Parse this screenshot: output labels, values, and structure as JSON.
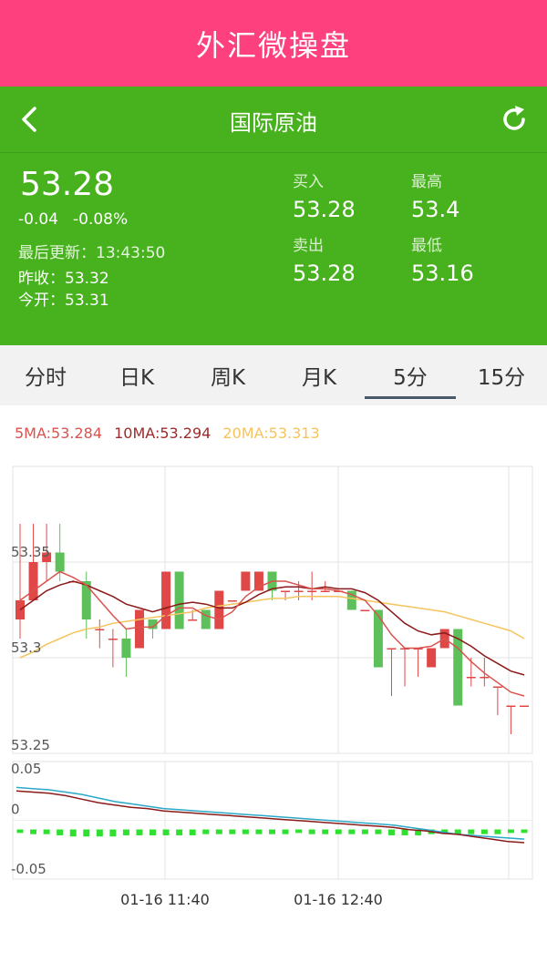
{
  "app": {
    "title": "外汇微操盘"
  },
  "nav": {
    "title": "国际原油"
  },
  "quote": {
    "price": "53.28",
    "change": "-0.04",
    "change_pct": "-0.08%",
    "updated_label": "最后更新：",
    "updated_time": "13:43:50",
    "prev_close_label": "昨收：",
    "prev_close": "53.32",
    "open_label": "今开：",
    "open": "53.31",
    "buy_label": "买入",
    "buy": "53.28",
    "high_label": "最高",
    "high": "53.4",
    "sell_label": "卖出",
    "sell": "53.28",
    "low_label": "最低",
    "low": "53.16"
  },
  "tabs": [
    {
      "label": "分时",
      "active": false
    },
    {
      "label": "日K",
      "active": false
    },
    {
      "label": "周K",
      "active": false
    },
    {
      "label": "月K",
      "active": false
    },
    {
      "label": "5分",
      "active": true
    },
    {
      "label": "15分",
      "active": false
    }
  ],
  "ma": {
    "ma5": "5MA:53.284",
    "ma10": "10MA:53.294",
    "ma20": "20MA:53.313"
  },
  "colors": {
    "up": "#e04848",
    "down": "#5ec05a",
    "ma5": "#d9534f",
    "ma10": "#8b1a1a",
    "ma20": "#f5c45e",
    "macd_line": "#2aa9c8",
    "signal_line": "#8b1a1a",
    "macd_bar": "#30e030"
  },
  "chart_data": [
    {
      "type": "candlestick",
      "y_ticks": [
        "53.35",
        "53.3",
        "53.25"
      ],
      "ylim": [
        53.25,
        53.4
      ],
      "x_ticks": [
        "01-16 11:40",
        "01-16 12:40"
      ],
      "candles": [
        {
          "o": 53.32,
          "h": 53.37,
          "l": 53.31,
          "c": 53.33
        },
        {
          "o": 53.33,
          "h": 53.37,
          "l": 53.33,
          "c": 53.35
        },
        {
          "o": 53.35,
          "h": 53.37,
          "l": 53.34,
          "c": 53.355
        },
        {
          "o": 53.355,
          "h": 53.37,
          "l": 53.34,
          "c": 53.345
        },
        {
          "o": 53.34,
          "h": 53.34,
          "l": 53.34,
          "c": 53.34
        },
        {
          "o": 53.34,
          "h": 53.345,
          "l": 53.31,
          "c": 53.32
        },
        {
          "o": 53.315,
          "h": 53.32,
          "l": 53.305,
          "c": 53.315
        },
        {
          "o": 53.31,
          "h": 53.315,
          "l": 53.295,
          "c": 53.31
        },
        {
          "o": 53.31,
          "h": 53.315,
          "l": 53.29,
          "c": 53.3
        },
        {
          "o": 53.305,
          "h": 53.325,
          "l": 53.305,
          "c": 53.325
        },
        {
          "o": 53.32,
          "h": 53.32,
          "l": 53.31,
          "c": 53.315
        },
        {
          "o": 53.315,
          "h": 53.345,
          "l": 53.315,
          "c": 53.345
        },
        {
          "o": 53.345,
          "h": 53.345,
          "l": 53.315,
          "c": 53.315
        },
        {
          "o": 53.32,
          "h": 53.325,
          "l": 53.32,
          "c": 53.32
        },
        {
          "o": 53.325,
          "h": 53.325,
          "l": 53.315,
          "c": 53.315
        },
        {
          "o": 53.315,
          "h": 53.335,
          "l": 53.315,
          "c": 53.335
        },
        {
          "o": 53.33,
          "h": 53.33,
          "l": 53.33,
          "c": 53.33
        },
        {
          "o": 53.335,
          "h": 53.345,
          "l": 53.335,
          "c": 53.345
        },
        {
          "o": 53.335,
          "h": 53.345,
          "l": 53.335,
          "c": 53.345
        },
        {
          "o": 53.345,
          "h": 53.345,
          "l": 53.33,
          "c": 53.335
        },
        {
          "o": 53.335,
          "h": 53.335,
          "l": 53.33,
          "c": 53.335
        },
        {
          "o": 53.335,
          "h": 53.34,
          "l": 53.33,
          "c": 53.335
        },
        {
          "o": 53.335,
          "h": 53.345,
          "l": 53.33,
          "c": 53.335
        },
        {
          "o": 53.335,
          "h": 53.34,
          "l": 53.335,
          "c": 53.335
        },
        {
          "o": 53.335,
          "h": 53.335,
          "l": 53.335,
          "c": 53.335
        },
        {
          "o": 53.335,
          "h": 53.335,
          "l": 53.325,
          "c": 53.325
        },
        {
          "o": 53.325,
          "h": 53.325,
          "l": 53.325,
          "c": 53.325
        },
        {
          "o": 53.325,
          "h": 53.325,
          "l": 53.295,
          "c": 53.295
        },
        {
          "o": 53.305,
          "h": 53.305,
          "l": 53.28,
          "c": 53.305
        },
        {
          "o": 53.305,
          "h": 53.305,
          "l": 53.285,
          "c": 53.305
        },
        {
          "o": 53.305,
          "h": 53.305,
          "l": 53.29,
          "c": 53.305
        },
        {
          "o": 53.295,
          "h": 53.305,
          "l": 53.295,
          "c": 53.305
        },
        {
          "o": 53.305,
          "h": 53.315,
          "l": 53.305,
          "c": 53.315
        },
        {
          "o": 53.315,
          "h": 53.315,
          "l": 53.275,
          "c": 53.275
        },
        {
          "o": 53.29,
          "h": 53.3,
          "l": 53.285,
          "c": 53.29
        },
        {
          "o": 53.29,
          "h": 53.3,
          "l": 53.285,
          "c": 53.29
        },
        {
          "o": 53.285,
          "h": 53.285,
          "l": 53.27,
          "c": 53.285
        },
        {
          "o": 53.275,
          "h": 53.275,
          "l": 53.26,
          "c": 53.275
        },
        {
          "o": 53.275,
          "h": 53.275,
          "l": 53.275,
          "c": 53.275
        }
      ],
      "ma5": [
        53.33,
        53.335,
        53.34,
        53.345,
        53.342,
        53.338,
        53.33,
        53.322,
        53.315,
        53.316,
        53.316,
        53.322,
        53.326,
        53.326,
        53.322,
        53.32,
        53.324,
        53.332,
        53.337,
        53.34,
        53.34,
        53.338,
        53.336,
        53.336,
        53.335,
        53.333,
        53.33,
        53.322,
        53.312,
        53.305,
        53.305,
        53.306,
        53.31,
        53.305,
        53.298,
        53.292,
        53.287,
        53.282,
        53.28
      ],
      "ma10": [
        53.325,
        53.33,
        53.335,
        53.338,
        53.34,
        53.338,
        53.335,
        53.332,
        53.328,
        53.326,
        53.324,
        53.326,
        53.328,
        53.329,
        53.328,
        53.326,
        53.326,
        53.329,
        53.333,
        53.336,
        53.337,
        53.337,
        53.336,
        53.337,
        53.336,
        53.336,
        53.334,
        53.33,
        53.324,
        53.318,
        53.314,
        53.312,
        53.313,
        53.31,
        53.306,
        53.301,
        53.297,
        53.293,
        53.291
      ],
      "ma20": [
        53.3,
        53.303,
        53.307,
        53.31,
        53.313,
        53.315,
        53.316,
        53.318,
        53.319,
        53.32,
        53.321,
        53.322,
        53.323,
        53.324,
        53.326,
        53.327,
        53.328,
        53.329,
        53.33,
        53.331,
        53.331,
        53.332,
        53.332,
        53.332,
        53.332,
        53.331,
        53.33,
        53.329,
        53.328,
        53.327,
        53.326,
        53.325,
        53.324,
        53.322,
        53.32,
        53.318,
        53.316,
        53.314,
        53.31
      ]
    },
    {
      "type": "line",
      "y_ticks": [
        "0.05",
        "0",
        "-0.05"
      ],
      "ylim": [
        -0.05,
        0.05
      ],
      "dif": [
        0.028,
        0.027,
        0.026,
        0.024,
        0.022,
        0.019,
        0.016,
        0.014,
        0.012,
        0.01,
        0.009,
        0.008,
        0.007,
        0.006,
        0.005,
        0.004,
        0.003,
        0.002,
        0.001,
        0.0,
        -0.001,
        -0.002,
        -0.003,
        -0.004,
        -0.006,
        -0.008,
        -0.01,
        -0.012,
        -0.013,
        -0.014,
        -0.015,
        -0.016
      ],
      "dea": [
        0.025,
        0.024,
        0.023,
        0.021,
        0.018,
        0.015,
        0.013,
        0.011,
        0.01,
        0.008,
        0.007,
        0.006,
        0.005,
        0.004,
        0.003,
        0.002,
        0.001,
        0.0,
        -0.001,
        -0.002,
        -0.003,
        -0.004,
        -0.005,
        -0.006,
        -0.008,
        -0.009,
        -0.011,
        -0.012,
        -0.014,
        -0.016,
        -0.018,
        -0.019
      ],
      "bars": [
        -0.003,
        -0.004,
        -0.004,
        -0.005,
        -0.006,
        -0.006,
        -0.006,
        -0.006,
        -0.005,
        -0.005,
        -0.005,
        -0.005,
        -0.005,
        -0.005,
        -0.004,
        -0.004,
        -0.004,
        -0.004,
        -0.004,
        -0.004,
        -0.004,
        -0.003,
        -0.004,
        -0.004,
        -0.004,
        -0.004,
        -0.004,
        -0.004,
        -0.005,
        -0.005,
        -0.005,
        -0.004,
        -0.004,
        -0.004,
        -0.004,
        -0.004,
        -0.004,
        -0.003,
        -0.003
      ]
    }
  ]
}
